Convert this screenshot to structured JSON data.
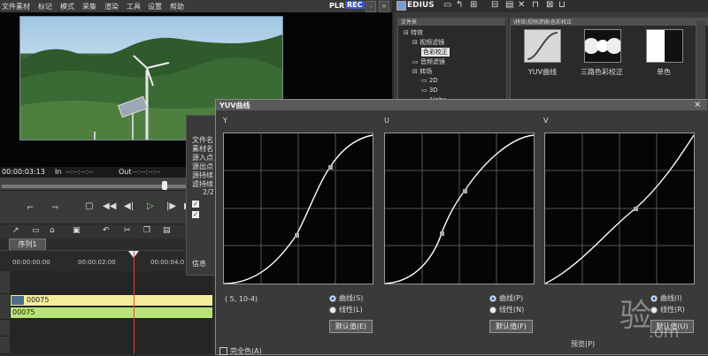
{
  "editor": {
    "menu": [
      "文件",
      "素材",
      "标记",
      "模式",
      "采集",
      "渲染",
      "工具",
      "设置",
      "帮助"
    ],
    "plr_label": "PLR",
    "rec_label": "REC",
    "timecode": "00:00:03:13",
    "in_label": "In",
    "in_value": "--:--:--:--",
    "out_label": "Out",
    "out_value": "--:--:--:--",
    "sequence_tab": "序列1",
    "ruler_marks": [
      "00:00:00:00",
      "00:00:02:00",
      "00:00:04:0"
    ],
    "clip1_label": "00075",
    "clip2_label": "00075"
  },
  "file_info": {
    "rows": [
      "文件名",
      "素材名",
      "源入点",
      "源出点",
      "源持续",
      "滤持续"
    ],
    "page": "2/2",
    "footer": "信息"
  },
  "edius": {
    "title": "EDIUS",
    "tree_header": "文件夹",
    "tree_items": [
      "特效",
      "视频滤镜",
      "色彩校正",
      "音频滤镜",
      "转场",
      "2D",
      "3D",
      "Alpha"
    ],
    "effects_header": "\\特效\\视频滤镜\\色彩校正",
    "effects": [
      {
        "label": "YUV曲线",
        "icon": "yuv-curve-thumbnail"
      },
      {
        "label": "三路色彩校正",
        "icon": "three-way-color-thumbnail"
      },
      {
        "label": "单色",
        "icon": "monochrome-thumbnail"
      }
    ]
  },
  "dialog": {
    "title": "YUV曲线",
    "close": "×",
    "plots": [
      {
        "label": "Y",
        "radio1": "曲线(S)",
        "radio2": "线性(L)",
        "button": "默认值(E)"
      },
      {
        "label": "U",
        "radio1": "曲线(P)",
        "radio2": "线性(N)",
        "button": "默认值(F)"
      },
      {
        "label": "V",
        "radio1": "曲线(I)",
        "radio2": "线性(R)",
        "button": "默认值(U)"
      }
    ],
    "coordinate": "( 5, 10-4)",
    "all_channels_checkbox": "完全色(A)",
    "preview_label": "预览(P)"
  },
  "watermark": {
    "main": "验",
    "sub": ".om"
  },
  "colors": {
    "accent_blue": "#3a55d6",
    "clip_yellow": "#f3ec9a",
    "clip_green": "#b9e27a",
    "curve": "#ffffff",
    "playhead": "#e04a4a"
  }
}
